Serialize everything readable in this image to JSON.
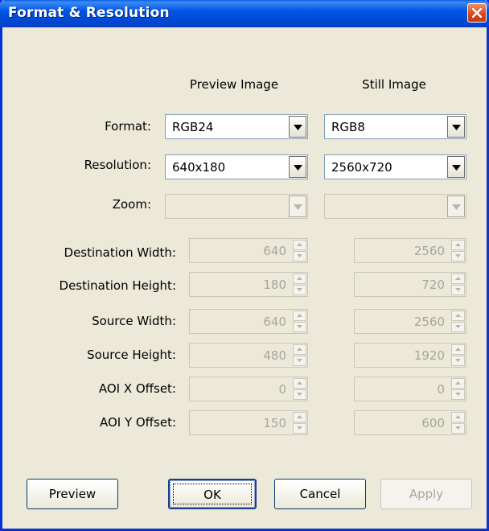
{
  "window": {
    "title": "Format & Resolution"
  },
  "headers": {
    "preview": "Preview Image",
    "still": "Still Image"
  },
  "rows": {
    "format": {
      "label": "Format:",
      "preview": "RGB24",
      "still": "RGB8"
    },
    "resolution": {
      "label": "Resolution:",
      "preview": "640x180",
      "still": "2560x720"
    },
    "zoom": {
      "label": "Zoom:",
      "preview": "",
      "still": ""
    }
  },
  "spinners": [
    {
      "label": "Destination Width:",
      "preview": "640",
      "still": "2560"
    },
    {
      "label": "Destination Height:",
      "preview": "180",
      "still": "720"
    },
    {
      "label": "Source Width:",
      "preview": "640",
      "still": "2560"
    },
    {
      "label": "Source Height:",
      "preview": "480",
      "still": "1920"
    },
    {
      "label": "AOI X Offset:",
      "preview": "0",
      "still": "0"
    },
    {
      "label": "AOI Y Offset:",
      "preview": "150",
      "still": "600"
    }
  ],
  "buttons": {
    "preview": "Preview",
    "ok": "OK",
    "cancel": "Cancel",
    "apply": "Apply"
  },
  "icons": {
    "close": "close-icon",
    "dropdown": "chevron-down-icon",
    "spin_up": "spin-up-icon",
    "spin_down": "spin-down-icon"
  },
  "colors": {
    "titlebar": "#0055e5",
    "dialog_bg": "#ece9d8",
    "disabled_text": "#a7a69c",
    "close": "#d94a1c"
  }
}
